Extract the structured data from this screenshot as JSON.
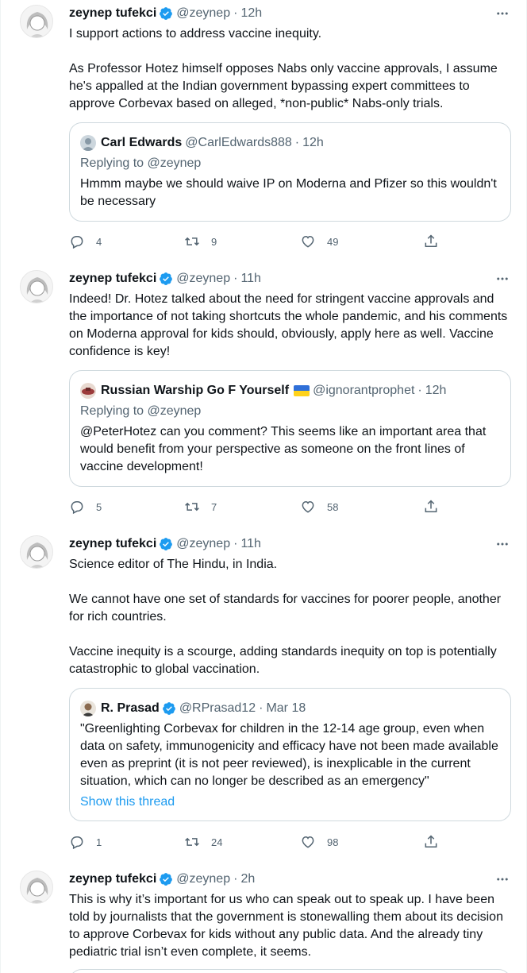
{
  "author": {
    "name": "zeynep tufekci",
    "handle": "@zeynep",
    "verified_icon": "verified-badge-icon"
  },
  "tweets": [
    {
      "time": "12h",
      "text": "I support actions to address vaccine inequity.\n\nAs Professor Hotez himself opposes Nabs only vaccine approvals, I assume he's appalled at the Indian government bypassing expert committees to approve Corbevax based on alleged, *non-public* Nabs-only trials.",
      "quote": {
        "name": "Carl Edwards",
        "handle": "@CarlEdwards888",
        "time": "12h",
        "replying": "Replying to @zeynep",
        "text": "Hmmm maybe we should waive IP on Moderna and Pfizer so this wouldn't be necessary"
      },
      "replies": "4",
      "retweets": "9",
      "likes": "49"
    },
    {
      "time": "11h",
      "text": "Indeed! Dr. Hotez talked about the need for stringent vaccine approvals and the importance of not taking shortcuts the whole pandemic, and his comments on Moderna approval for kids should, obviously, apply here as well. Vaccine confidence is key!",
      "quote": {
        "name": "Russian Warship Go F Yourself",
        "handle": "@ignorantprophet",
        "time": "12h",
        "replying": "Replying to @zeynep",
        "text": "@PeterHotez can you comment? This seems like an important area that would benefit from your perspective as someone on the front lines of vaccine development!"
      },
      "replies": "5",
      "retweets": "7",
      "likes": "58"
    },
    {
      "time": "11h",
      "text": "Science editor of The Hindu, in India.\n\nWe cannot have one set of standards for vaccines for poorer people, another for rich countries.\n\nVaccine inequity is a scourge, adding standards inequity on top is potentially catastrophic to global vaccination.",
      "quote": {
        "name": "R. Prasad",
        "handle": "@RPrasad12",
        "time": "Mar 18",
        "text": "\"Greenlighting Corbevax for children in the 12-14 age group, even when data on safety, immunogenicity and efficacy have not been made available even as preprint (it is not peer reviewed), is inexplicable in the current situation, which can no longer be described as an emergency\"",
        "show_thread": "Show this thread"
      },
      "replies": "1",
      "retweets": "24",
      "likes": "98"
    },
    {
      "time": "2h",
      "text": "This is why it’s important for us who can speak out to speak up. I have been told by journalists that the government is stonewalling them about its decision to approve Corbevax for kids without any public data. And the already tiny pediatric trial isn’t even complete, it seems."
    }
  ],
  "colors": {
    "text": "#0f1419",
    "secondary": "#536471",
    "accent": "#1d9bf0",
    "border": "#cfd9de"
  },
  "separator": "·"
}
